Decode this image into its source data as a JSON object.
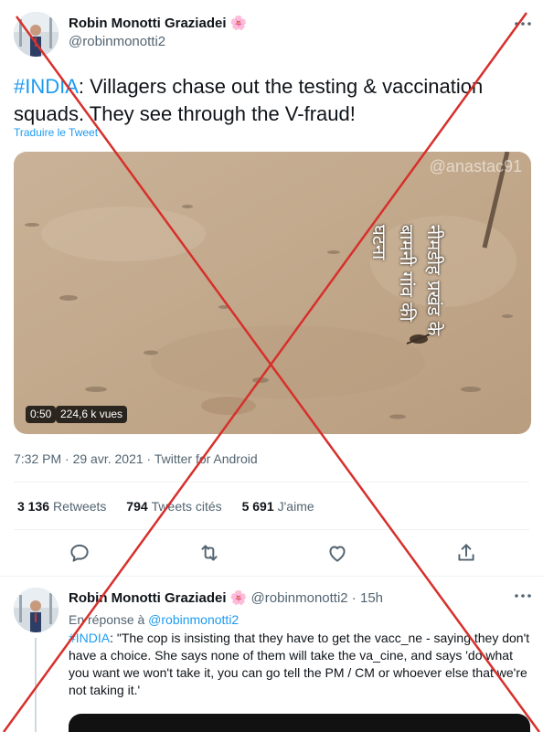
{
  "tweet": {
    "author_name": "Robin Monotti Graziadei",
    "author_emoji": "🌸",
    "author_handle": "@robinmonotti2",
    "hashtag": "#INDIA",
    "text": ": Villagers chase out the testing & vaccination squads. They see through the V-fraud!",
    "translate_label": "Traduire le Tweet",
    "video": {
      "watermark": "@anastac91",
      "overlay_text": [
        "नीमडीह प्रखंड के",
        "बामनी गांव की",
        "घटना"
      ],
      "duration": "0:50",
      "views": "224,6 k vues"
    },
    "timestamp": "7:32 PM · 29 avr. 2021 · Twitter for Android",
    "stats": {
      "retweets_count": "3 136",
      "retweets_label": "Retweets",
      "quotes_count": "794",
      "quotes_label": "Tweets cités",
      "likes_count": "5 691",
      "likes_label": "J'aime"
    },
    "actions": [
      "reply-icon",
      "retweet-icon",
      "like-icon",
      "share-icon"
    ]
  },
  "reply": {
    "author_name": "Robin Monotti Graziadei",
    "author_emoji": "🌸",
    "author_handle_time": "@robinmonotti2 · 15h",
    "replying_prefix": "En réponse à ",
    "replying_to": "@robinmonotti2",
    "hashtag": "#INDIA",
    "text": ": \"The cop is insisting that they have to get the vacc_ne - saying they don't have a choice. She says none of them will take the va_cine, and says 'do what you want we won't take it, you can go tell the PM / CM or whoever else that we're not taking it.'"
  },
  "colors": {
    "accent": "#1d9bf0",
    "cross": "#d7302b",
    "secondary_text": "#536471"
  }
}
